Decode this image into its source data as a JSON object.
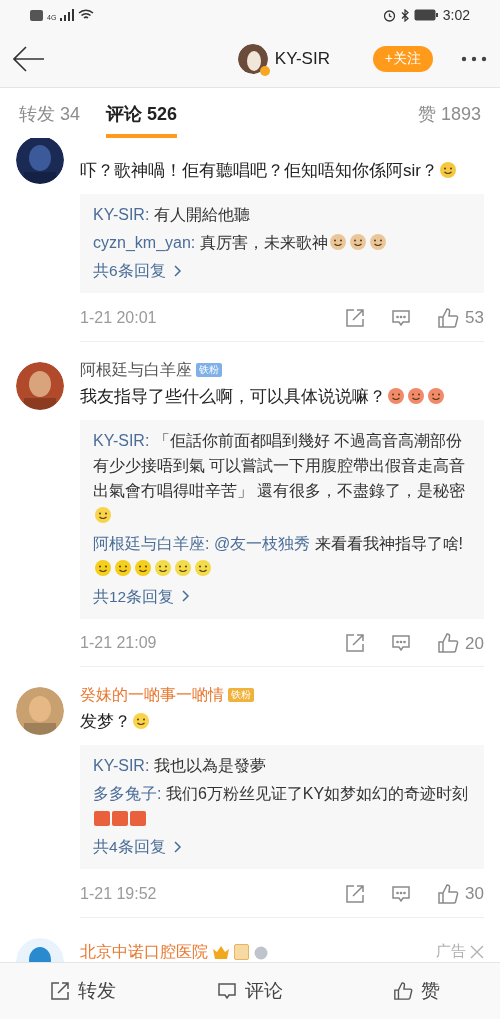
{
  "status_bar": {
    "network": "4G",
    "time": "3:02"
  },
  "header": {
    "username": "KY-SIR",
    "follow_label": "+关注"
  },
  "tabs": [
    {
      "label": "转发 34",
      "selected": false
    },
    {
      "label": "评论 526",
      "selected": true
    },
    {
      "label": "赞 1893",
      "selected": false
    }
  ],
  "comments": [
    {
      "kind": "comment",
      "text": "吓？歌神喎！佢有聽唱吧？佢知唔知你係阿sir？",
      "emojis": [
        {
          "kind": "grin"
        }
      ],
      "replies": [
        {
          "author": "KY-SIR:",
          "text": "有人開給他聽"
        },
        {
          "author": "cyzn_km_yan:",
          "text": "真厉害，未来歌神",
          "emojis": [
            {
              "kind": "thumb"
            },
            {
              "kind": "thumb"
            },
            {
              "kind": "thumb"
            }
          ]
        }
      ],
      "more": "共6条回复",
      "time": "1-21 20:01",
      "likes": "53"
    },
    {
      "kind": "comment",
      "name": "阿根廷与白羊座",
      "name_orange": false,
      "badge": "铁粉",
      "text": "我友指导了些什么啊，可以具体说说嘛？",
      "emojis": [
        {
          "kind": "laugh"
        },
        {
          "kind": "laugh"
        },
        {
          "kind": "laugh"
        }
      ],
      "replies": [
        {
          "author": "KY-SIR:",
          "text": "「佢話你前面都唱到幾好 不過高音高潮部份有少少接唔到氣 可以嘗試一下用腹腔帶出假音走高音出氣會冇唱得咁辛苦」 還有很多，不盡錄了，是秘密",
          "emojis": [
            {
              "kind": "smile"
            }
          ]
        },
        {
          "author": "阿根廷与白羊座:",
          "mention": "@友一枝独秀",
          "text": "来看看我神指导了啥!",
          "emojis": [
            {
              "kind": "lemon"
            },
            {
              "kind": "lemon"
            },
            {
              "kind": "lemon"
            },
            {
              "kind": "lemonface"
            },
            {
              "kind": "lemonface"
            },
            {
              "kind": "lemonface"
            }
          ]
        }
      ],
      "more": "共12条回复",
      "time": "1-21 21:09",
      "likes": "20"
    },
    {
      "kind": "comment",
      "name": "癸妹的一啲事一啲情",
      "name_orange": true,
      "badge": "铁粉",
      "text": "发梦？",
      "emojis": [
        {
          "kind": "smile"
        }
      ],
      "replies": [
        {
          "author": "KY-SIR:",
          "text": "我也以為是發夢"
        },
        {
          "author": "多多兔子:",
          "text": "我们6万粉丝见证了KY如梦如幻的奇迹时刻",
          "emojis": [
            {
              "kind": "zan"
            },
            {
              "kind": "zan"
            },
            {
              "kind": "zan"
            }
          ]
        }
      ],
      "more": "共4条回复",
      "time": "1-21 19:52",
      "likes": "30"
    },
    {
      "kind": "ad",
      "name": "北京中诺口腔医院",
      "name_orange": true,
      "ad_label": "广告"
    }
  ],
  "bottom_bar": [
    {
      "label": "转发",
      "kind": "repost"
    },
    {
      "label": "评论",
      "kind": "comment"
    },
    {
      "label": "赞",
      "kind": "like"
    }
  ]
}
